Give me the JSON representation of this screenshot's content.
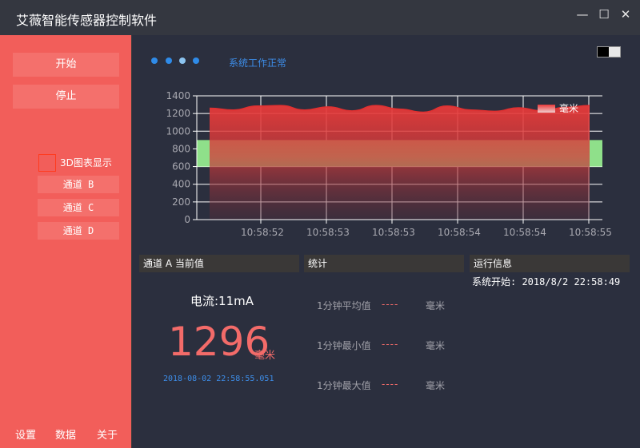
{
  "window": {
    "title": "艾薇智能传感器控制软件",
    "minimize": "—",
    "maximize": "☐",
    "close": "✕"
  },
  "sidebar": {
    "start_label": "开始",
    "stop_label": "停止",
    "chk3d_label": "3D图表显示",
    "channels": [
      "通道 B",
      "通道 C",
      "通道 D"
    ],
    "footer": [
      "设置",
      "数据",
      "关于"
    ]
  },
  "status": {
    "text": "系统工作正常",
    "dot_colors": [
      "#2f8be8",
      "#2f8be8",
      "#8cc4f0",
      "#2f8be8"
    ]
  },
  "chart_data": {
    "type": "area",
    "title": "",
    "xlabel": "",
    "ylabel": "",
    "ylim": [
      0,
      1400
    ],
    "yticks": [
      0,
      200,
      400,
      600,
      800,
      1000,
      1200,
      1400
    ],
    "xticks": [
      "10:58:52",
      "10:58:53",
      "10:58:53",
      "10:58:54",
      "10:58:54",
      "10:58:55"
    ],
    "series": [
      {
        "name": "毫米",
        "color": "#e83a3a",
        "values": [
          1260,
          1240,
          1285,
          1290,
          1240,
          1275,
          1230,
          1290,
          1250,
          1215,
          1285,
          1240,
          1225,
          1265,
          1230,
          1270,
          1290
        ]
      }
    ],
    "band": {
      "from": 600,
      "to": 900,
      "color": "#8fe08a"
    },
    "grid": true,
    "legend": "top-right"
  },
  "panels": {
    "current": {
      "header": "通道 A 当前值",
      "label": "电流:11mA",
      "value": "1296",
      "unit": "毫米",
      "timestamp": "2018-08-02 22:58:55.051"
    },
    "stats": {
      "header": "统计",
      "rows": [
        {
          "label": "1分钟平均值",
          "value": "----",
          "unit": "毫米"
        },
        {
          "label": "1分钟最小值",
          "value": "----",
          "unit": "毫米"
        },
        {
          "label": "1分钟最大值",
          "value": "----",
          "unit": "毫米"
        }
      ]
    },
    "run": {
      "header": "运行信息",
      "start": "系统开始: 2018/8/2 22:58:49"
    }
  }
}
